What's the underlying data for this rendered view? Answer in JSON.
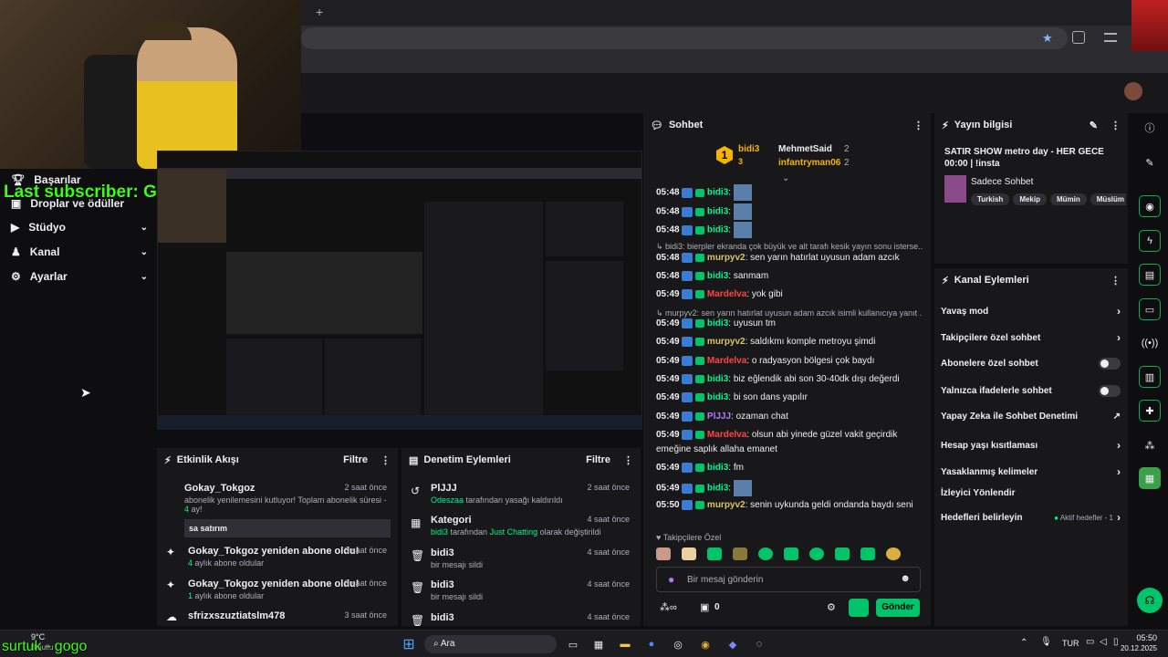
{
  "browser": {
    "new_tab": "+",
    "star": "★"
  },
  "overlay": {
    "last_subscriber": "Last subscriber: Gokay_Tokgoz",
    "weather_temp": "9°C",
    "weather_text": "Bulutlu",
    "bottom_text": "surtuk - gogo"
  },
  "nav": {
    "items": [
      {
        "label": "Başarılar"
      },
      {
        "label": "Droplar ve ödüller"
      },
      {
        "label": "Stüdyo"
      },
      {
        "label": "Kanal"
      },
      {
        "label": "Ayarlar"
      }
    ]
  },
  "activity": {
    "title": "Etkinlik Akışı",
    "filter": "Filtre",
    "items": [
      {
        "title": "Gokay_Tokgoz",
        "time": "2 saat önce",
        "sub_pre": "abonelik yenilemesini kutluyor! Toplam abonelik süresi - ",
        "sub_num": "4",
        "sub_post": " ay!",
        "message": "sa satırım"
      },
      {
        "title": "Gokay_Tokgoz yeniden abone oldu!",
        "time": "3 saat önce",
        "num": "4",
        "sub": " aylık abone oldular"
      },
      {
        "title": "Gokay_Tokgoz yeniden abone oldu!",
        "time": "3 saat önce",
        "num": "1",
        "sub": " aylık abone oldular"
      },
      {
        "title": "sfrizxszuztiatslm478",
        "time": "3 saat önce"
      }
    ]
  },
  "moderation": {
    "title": "Denetim Eylemleri",
    "filter": "Filtre",
    "items": [
      {
        "title": "PlJJJ",
        "time": "2 saat önce",
        "actor": "Odeszaa",
        "sub": " tarafından yasağı kaldırıldı"
      },
      {
        "title": "Kategori",
        "time": "4 saat önce",
        "actor": "bidi3",
        "sub": " tarafından ",
        "extra": "Just Chatting",
        "sub2": " olarak değiştirildi"
      },
      {
        "title": "bidi3",
        "time": "4 saat önce",
        "sub": "bir mesajı sildi"
      },
      {
        "title": "bidi3",
        "time": "4 saat önce",
        "sub": "bir mesajı sildi"
      },
      {
        "title": "bidi3",
        "time": "4 saat önce"
      }
    ]
  },
  "chat": {
    "title": "Sohbet",
    "leaders": {
      "first_name": "bidi3",
      "first_count": "3",
      "second_name": "MehmetSaid",
      "second_count": "2",
      "third_name": "infantryman06",
      "third_count": "2",
      "rank": "1"
    },
    "lines": [
      {
        "ts": "05:48",
        "user": "bidi3",
        "msg": ":",
        "color": "#00f593",
        "img": true
      },
      {
        "ts": "05:48",
        "user": "bidi3",
        "msg": ":",
        "color": "#00f593",
        "img": true
      },
      {
        "ts": "05:48",
        "user": "bidi3",
        "msg": ":",
        "color": "#00f593",
        "img": true
      },
      {
        "sys": "↳ bidi3: bierpler ekranda çok büyük ve alt tarafı kesik yayın sonu isterse..."
      },
      {
        "ts": "05:48",
        "user": "murpyv2",
        "msg": ": sen yarın hatırlat uyusun adam azcık",
        "color": "#d8c46a"
      },
      {
        "ts": "05:48",
        "user": "bidi3",
        "msg": ": sanmam",
        "color": "#00f593"
      },
      {
        "ts": "05:49",
        "user": "Mardelva",
        "msg": ": yok gibi",
        "color": "#ff4444"
      },
      {
        "sys": "↳ murpyv2: sen yarın hatırlat uyusun adam azcık isimli kullanıcıya yanıt ..."
      },
      {
        "ts": "05:49",
        "user": "bidi3",
        "msg": ": uyusun tm",
        "color": "#00f593"
      },
      {
        "ts": "05:49",
        "user": "murpyv2",
        "msg": ": saldıkmı komple metroyu şimdi",
        "color": "#d8c46a"
      },
      {
        "ts": "05:49",
        "user": "Mardelva",
        "msg": ": o radyasyon bölgesi çok baydı",
        "color": "#ff4444"
      },
      {
        "ts": "05:49",
        "user": "bidi3",
        "msg": ": biz eğlendik abi son 30-40dk dışı değerdi",
        "color": "#00f593"
      },
      {
        "ts": "05:49",
        "user": "bidi3",
        "msg": ": bi son dans yapılır",
        "color": "#00f593"
      },
      {
        "ts": "05:49",
        "user": "PlJJJ",
        "msg": ": ozaman chat",
        "color": "#b07aff"
      },
      {
        "ts": "05:49",
        "user": "Mardelva",
        "msg": ": olsun abi yinede güzel vakit geçirdik",
        "color": "#ff4444"
      },
      {
        "cont": "emeğine saplık allaha emanet"
      },
      {
        "ts": "05:49",
        "user": "bidi3",
        "msg": ": fm",
        "color": "#00f593"
      },
      {
        "ts": "05:49",
        "user": "bidi3",
        "msg": ":",
        "color": "#00f593",
        "img": true
      },
      {
        "ts": "05:50",
        "user": "murpyv2",
        "msg": ": senin uykunda geldi ondanda baydı seni",
        "color": "#d8c46a"
      }
    ],
    "followers_only": "Takipçilere Özel",
    "placeholder": "Bir mesaj gönderin",
    "points": "0",
    "send": "Gönder"
  },
  "stream_info": {
    "title": "Yayın bilgisi",
    "stream_title": "SATIR SHOW metro day - HER GECE 00:00 | !insta",
    "category": "Sadece Sohbet",
    "tags": [
      "Turkish",
      "Mekip",
      "Mümin",
      "Müslüm"
    ]
  },
  "channel_actions": {
    "title": "Kanal Eylemleri",
    "items": [
      {
        "label": "Yavaş mod",
        "kind": "arrow"
      },
      {
        "label": "Takipçilere özel sohbet",
        "kind": "arrow"
      },
      {
        "label": "Abonelere özel sohbet",
        "kind": "toggle"
      },
      {
        "label": "Yalnızca ifadelerle sohbet",
        "kind": "toggle"
      },
      {
        "label": "Yapay Zeka ile Sohbet Denetimi",
        "kind": "ext"
      },
      {
        "label": "Hesap yaşı kısıtlaması",
        "kind": "arrow"
      },
      {
        "label": "Yasaklanmış kelimeler",
        "kind": "arrow"
      },
      {
        "label": "İzleyici Yönlendir",
        "kind": "none"
      },
      {
        "label": "Hedefleri belirleyin",
        "kind": "goal",
        "extra": "Aktif hedefler - 1"
      }
    ]
  },
  "taskbar": {
    "search": "Ara",
    "lang": "TUR",
    "time": "05:50",
    "date": "20.12.2025"
  }
}
